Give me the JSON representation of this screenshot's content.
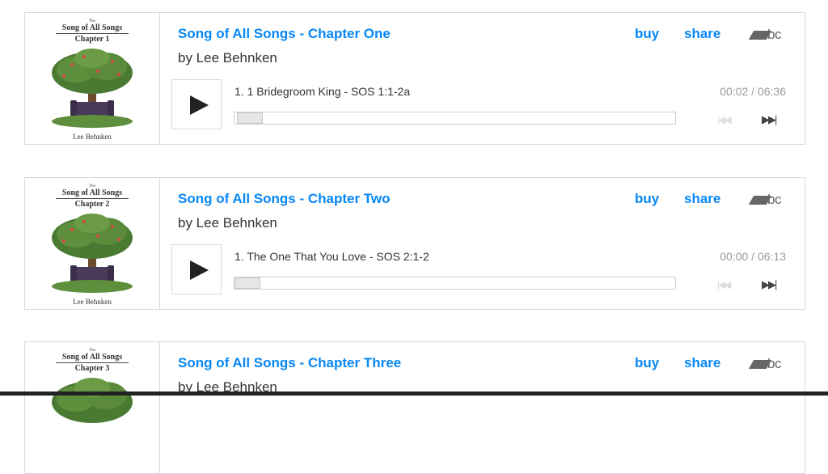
{
  "players": [
    {
      "album_title": "Song of All Songs - Chapter One",
      "artist": "by Lee Behnken",
      "buy_label": "buy",
      "share_label": "share",
      "brand_label": "bc",
      "art": {
        "small": "The",
        "title": "Song of All Songs",
        "chapter": "Chapter 1",
        "author": "Lee Behnken"
      },
      "track": "1.  1 Bridegroom King - SOS 1:1-2a",
      "time": "00:02 / 06:36",
      "progress": 0.005
    },
    {
      "album_title": "Song of All Songs - Chapter Two",
      "artist": "by Lee Behnken",
      "buy_label": "buy",
      "share_label": "share",
      "brand_label": "bc",
      "art": {
        "small": "The",
        "title": "Song of All Songs",
        "chapter": "Chapter 2",
        "author": "Lee Behnken"
      },
      "track": "1.  The One That You Love - SOS 2:1-2",
      "time": "00:00 / 06:13",
      "progress": 0
    },
    {
      "album_title": "Song of All Songs - Chapter Three",
      "artist": "by Lee Behnken",
      "buy_label": "buy",
      "share_label": "share",
      "brand_label": "bc",
      "art": {
        "small": "The",
        "title": "Song of All Songs",
        "chapter": "Chapter 3",
        "author": ""
      }
    }
  ],
  "colors": {
    "link": "#0687f5",
    "brand": "#666666"
  },
  "icons": {
    "play": "play-icon",
    "prev": "previous-track-icon",
    "next": "next-track-icon",
    "brand": "bandcamp-logo-icon"
  }
}
